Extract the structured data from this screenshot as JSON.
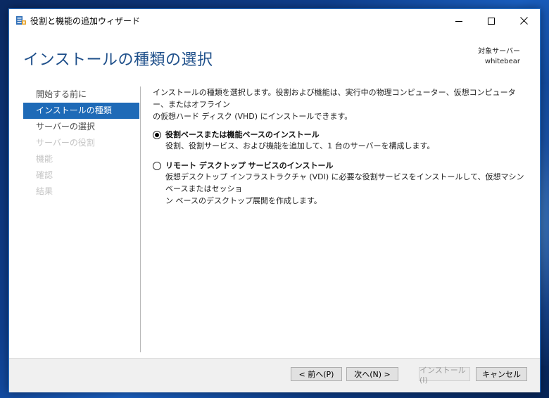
{
  "window": {
    "title": "役割と機能の追加ウィザード",
    "app_icon": "server-manager-icon",
    "controls": {
      "minimize_icon": "minimize-icon",
      "maximize_icon": "maximize-icon",
      "close_icon": "close-icon"
    }
  },
  "header": {
    "page_title": "インストールの種類の選択",
    "target_label": "対象サーバー",
    "target_name": "whitebear"
  },
  "nav": {
    "items": [
      {
        "label": "開始する前に",
        "state": "normal"
      },
      {
        "label": "インストールの種類",
        "state": "active"
      },
      {
        "label": "サーバーの選択",
        "state": "normal"
      },
      {
        "label": "サーバーの役割",
        "state": "disabled"
      },
      {
        "label": "機能",
        "state": "disabled"
      },
      {
        "label": "確認",
        "state": "disabled"
      },
      {
        "label": "結果",
        "state": "disabled"
      }
    ]
  },
  "content": {
    "intro_line1": "インストールの種類を選択します。役割および機能は、実行中の物理コンピューター、仮想コンピューター、またはオフライン",
    "intro_line2": "の仮想ハード ディスク (VHD) にインストールできます。",
    "options": [
      {
        "title": "役割ベースまたは機能ベースのインストール",
        "desc_line1": "役割、役割サービス、および機能を追加して、1 台のサーバーを構成します。",
        "desc_line2": "",
        "selected": true
      },
      {
        "title": "リモート デスクトップ サービスのインストール",
        "desc_line1": "仮想デスクトップ インフラストラクチャ (VDI) に必要な役割サービスをインストールして、仮想マシン ベースまたはセッショ",
        "desc_line2": "ン ベースのデスクトップ展開を作成します。",
        "selected": false
      }
    ]
  },
  "footer": {
    "prev_label": "< 前へ(P)",
    "next_label": "次へ(N) >",
    "install_label": "インストール(I)",
    "cancel_label": "キャンセル"
  },
  "colors": {
    "accent": "#1e6ab7",
    "title_blue": "#1e4f8a",
    "disabled_text": "#c4c4c4"
  }
}
